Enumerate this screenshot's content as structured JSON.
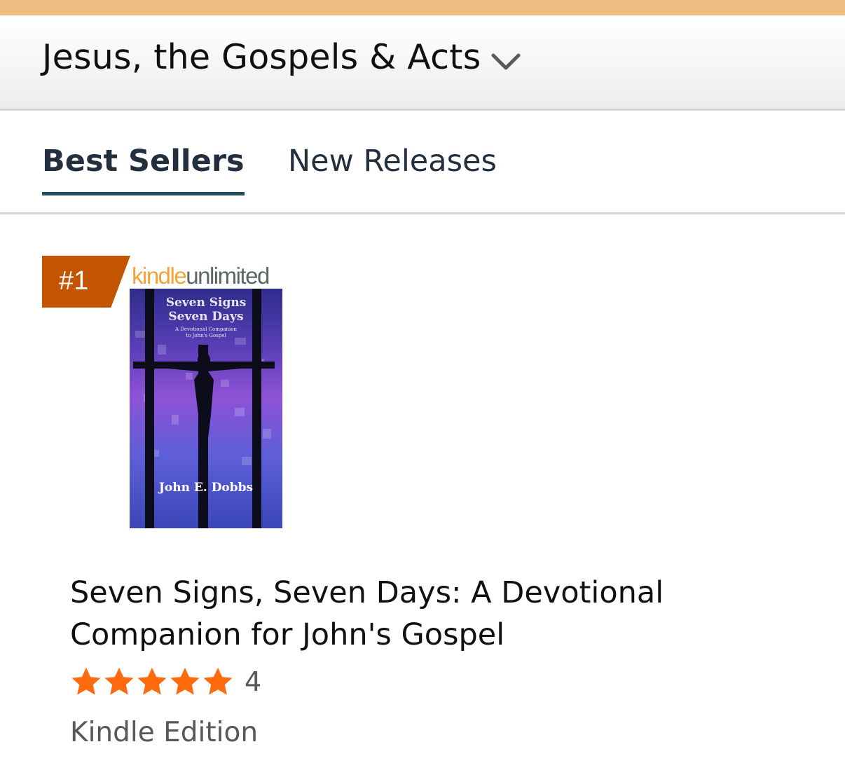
{
  "category": {
    "title": "Jesus, the Gospels & Acts",
    "dropdown_icon": "chevron-down-icon"
  },
  "tabs": [
    {
      "label": "Best Sellers",
      "active": true
    },
    {
      "label": "New Releases",
      "active": false
    }
  ],
  "item": {
    "rank": "#1",
    "badge_logo_kindle": "kindle",
    "badge_logo_unlimited": "unlimited",
    "cover": {
      "title_line1": "Seven Signs",
      "title_line2": "Seven Days",
      "subtitle_line1": "A Devotional Companion",
      "subtitle_line2": "to John's Gospel",
      "author": "John E. Dobbs"
    },
    "title_line1": "Seven Signs, Seven Days: A Devotional",
    "title_line2": "Companion for John's Gospel",
    "rating_stars": 5,
    "rating_count": "4",
    "format": "Kindle Edition"
  },
  "colors": {
    "accent_strip": "#eebc80",
    "badge": "#c45500",
    "star": "#ff6a0e",
    "tab_underline": "#1f4e63"
  }
}
